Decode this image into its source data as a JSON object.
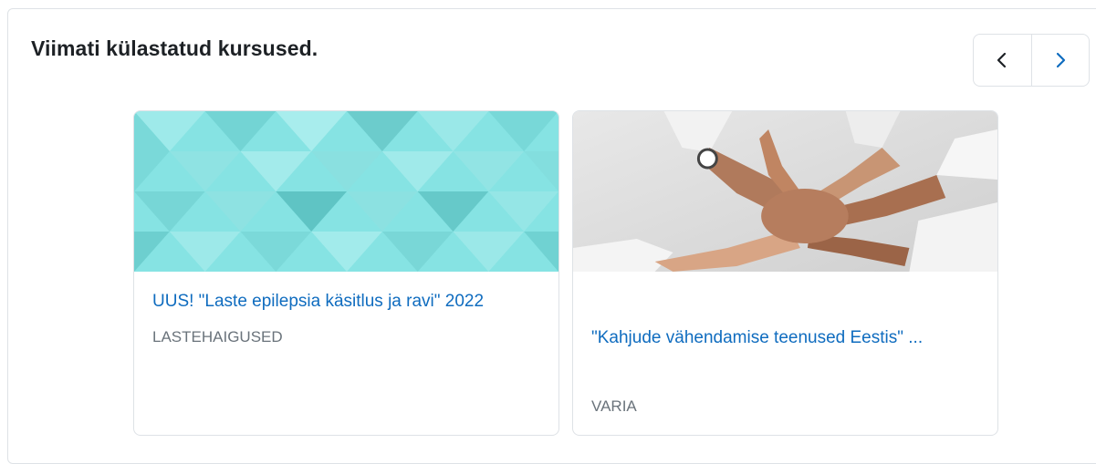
{
  "section": {
    "title": "Viimati külastatud kursused."
  },
  "nav": {
    "prev_icon": "chevron-left-icon",
    "next_icon": "chevron-right-icon"
  },
  "courses": [
    {
      "name": "UUS! \"Laste epilepsia käsitlus ja ravi\" 2022",
      "category": "LASTEHAIGUSED",
      "image": "teal-triangle-pattern"
    },
    {
      "name": "\"Kahjude vähendamise teenused Eestis\" ...",
      "category": "VARIA",
      "image": "stacked-hands-photo"
    }
  ],
  "colors": {
    "link": "#0f6cbf",
    "muted": "#6a737b",
    "accent_teal": "#7fe0e0"
  }
}
